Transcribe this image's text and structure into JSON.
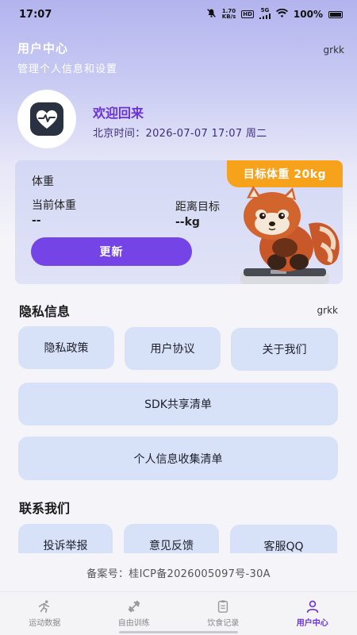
{
  "status_bar": {
    "time": "17:07",
    "net_speed_value": "1.70",
    "net_speed_unit": "KB/s",
    "hd_label": "HD",
    "signal_label": "5G",
    "battery": "100%"
  },
  "header": {
    "title": "用户中心",
    "subtitle": "管理个人信息和设置",
    "username": "grkk"
  },
  "profile": {
    "welcome": "欢迎回来",
    "time_label": "北京时间：2026-07-07 17:07 周二"
  },
  "weight_card": {
    "target_badge": "目标体重 20kg",
    "title": "体重",
    "current_label": "当前体重",
    "current_value": "--",
    "distance_label": "距离目标",
    "distance_value": "--kg",
    "update_button": "更新"
  },
  "privacy": {
    "title": "隐私信息",
    "username": "grkk",
    "buttons": [
      "隐私政策",
      "用户协议",
      "关于我们"
    ],
    "sdk_list": "SDK共享清单",
    "personal_info_list": "个人信息收集清单"
  },
  "contact": {
    "title": "联系我们",
    "buttons": [
      "投诉举报",
      "意见反馈",
      "客服QQ"
    ]
  },
  "beian": "备案号：桂ICP备2026005097号-30A",
  "tabbar": {
    "items": [
      {
        "label": "运动数据",
        "icon": "running-icon",
        "active": false
      },
      {
        "label": "自由训练",
        "icon": "dumbbell-icon",
        "active": false
      },
      {
        "label": "饮食记录",
        "icon": "clipboard-icon",
        "active": false
      },
      {
        "label": "用户中心",
        "icon": "user-icon",
        "active": true
      }
    ]
  },
  "colors": {
    "accent": "#7444e6",
    "badge": "#f7a21b",
    "button_bg": "#d7e2f8"
  }
}
